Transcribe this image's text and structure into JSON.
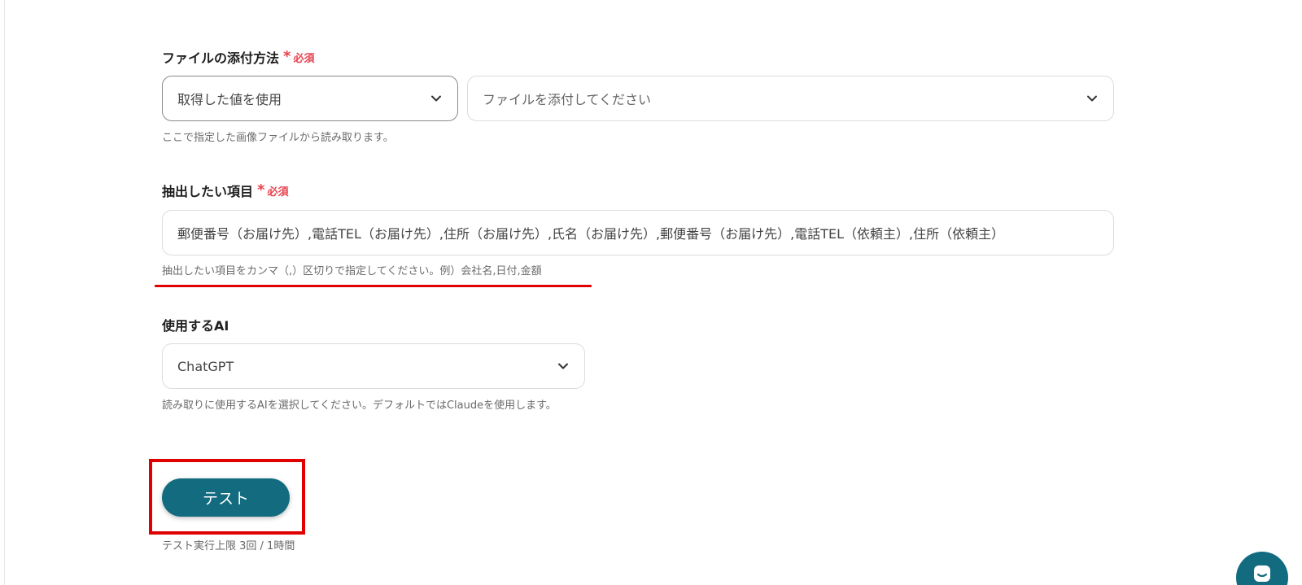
{
  "file_attach": {
    "label": "ファイルの添付方法",
    "required_mark": "*",
    "required_text": "必須",
    "method_select": {
      "value": "取得した値を使用"
    },
    "file_select": {
      "placeholder": "ファイルを添付してください"
    },
    "help": "ここで指定した画像ファイルから読み取ります。"
  },
  "extract_items": {
    "label": "抽出したい項目",
    "required_mark": "*",
    "required_text": "必須",
    "value": "郵便番号（お届け先）,電話TEL（お届け先）,住所（お届け先）,氏名（お届け先）,郵便番号（お届け先）,電話TEL（依頼主）,住所（依頼主）",
    "help": "抽出したい項目をカンマ（,）区切りで指定してください。例）会社名,日付,金額"
  },
  "ai_select": {
    "label": "使用するAI",
    "value": "ChatGPT",
    "help": "読み取りに使用するAIを選択してください。デフォルトではClaudeを使用します。"
  },
  "test": {
    "button_label": "テスト",
    "limit_text": "テスト実行上限 3回 / 1時間"
  },
  "colors": {
    "accent": "#136b80",
    "required": "#e8424f",
    "annotation": "#e00000"
  },
  "icons": {
    "dropdown": "chevron-down-icon",
    "chat": "chat-icon"
  }
}
